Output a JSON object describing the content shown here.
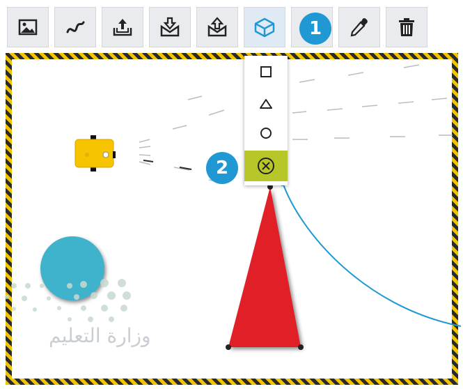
{
  "toolbar": {
    "buttons": [
      {
        "name": "image-icon"
      },
      {
        "name": "path-icon"
      },
      {
        "name": "export-icon"
      },
      {
        "name": "import-icon"
      },
      {
        "name": "upload-icon"
      },
      {
        "name": "shape-3d-icon",
        "active": true
      },
      {
        "name": "paint-bucket-icon"
      },
      {
        "name": "eyedropper-icon"
      },
      {
        "name": "trash-icon"
      }
    ],
    "accent": "#1f98d3"
  },
  "callouts": {
    "step1": "1",
    "step2": "2"
  },
  "shape_menu": {
    "items": [
      "square-icon",
      "triangle-icon",
      "circle-icon",
      "circle-x-icon"
    ],
    "selected_color": "#b7c72a"
  },
  "arena": {
    "triangle_color": "#e01f26",
    "ball_color": "#3fb2cc",
    "robot_color": "#f6c400"
  },
  "watermark": {
    "text": "وزارة التعليم"
  }
}
